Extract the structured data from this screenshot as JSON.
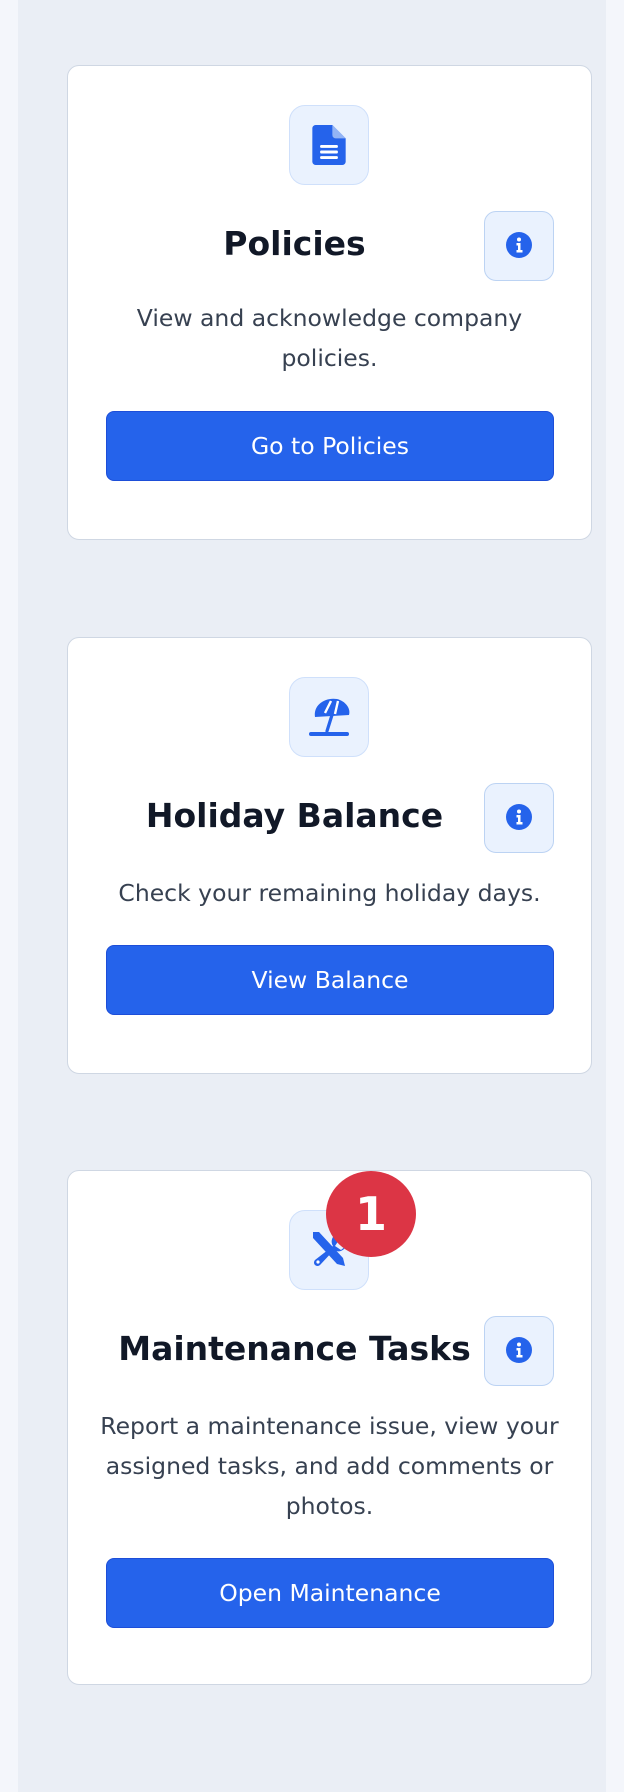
{
  "cards": [
    {
      "title": "Policies",
      "description": "View and acknowledge company policies.",
      "button_label": "Go to Policies",
      "icon": "document-icon"
    },
    {
      "title": "Holiday Balance",
      "description": "Check your remaining holiday days.",
      "button_label": "View Balance",
      "icon": "beach-umbrella-icon"
    },
    {
      "title": "Maintenance Tasks",
      "description": "Report a maintenance issue, view your assigned tasks, and add comments or photos.",
      "button_label": "Open Maintenance",
      "icon": "tools-icon",
      "badge_count": "1"
    }
  ],
  "info_icon": "info-icon",
  "colors": {
    "accent": "#2563eb",
    "badge": "#dc3545",
    "title": "#111827",
    "text": "#374151",
    "background": "#eaeef5"
  }
}
